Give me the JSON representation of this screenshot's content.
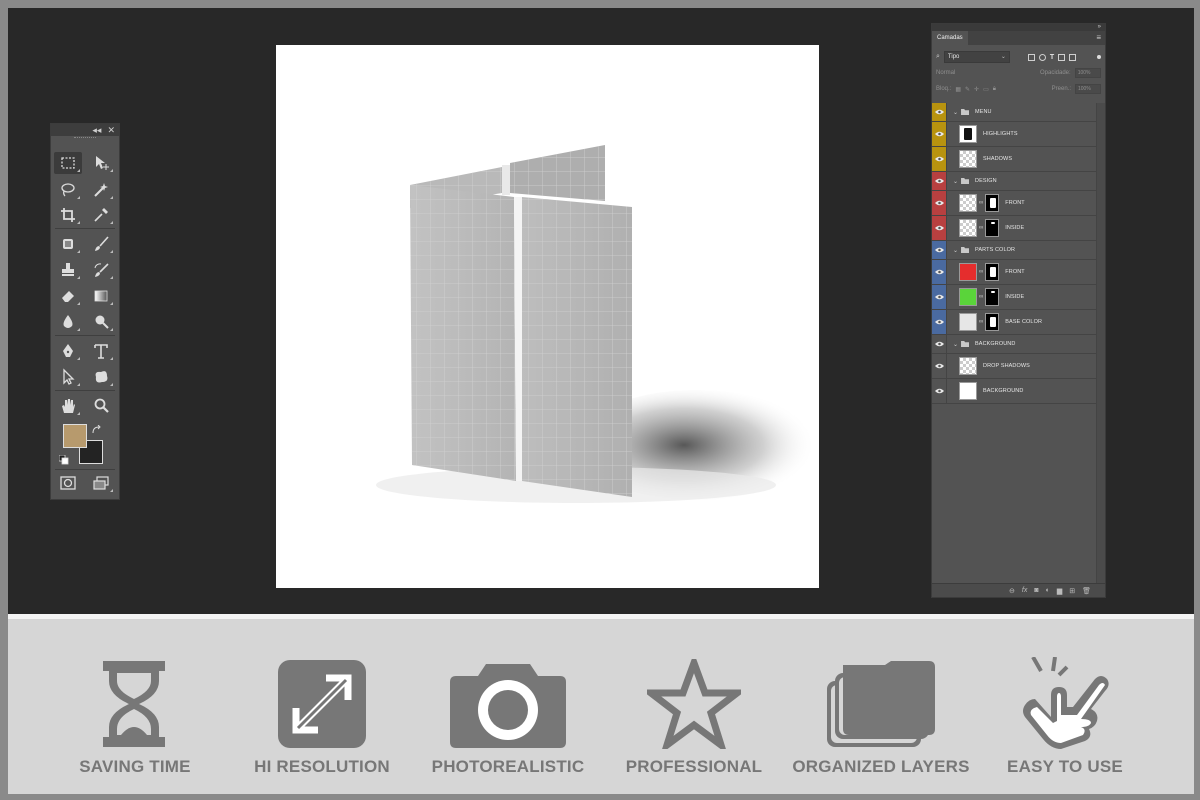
{
  "layers_panel": {
    "title": "Camadas",
    "collapse_glyph": "»",
    "menu_glyph": "≡",
    "filter_value": "Tipo",
    "blend_mode": "Normal",
    "opacity_label": "Opacidade:",
    "opacity_value": "100%",
    "lock_label": "Bloq.:",
    "fill_label": "Preen.:",
    "fill_value": "100%",
    "layers": [
      {
        "kind": "group",
        "name": "MENU",
        "tag_color": "#b8930f"
      },
      {
        "kind": "layer",
        "name": "HIGHLIGHTS",
        "tag_color": "#b8930f",
        "thumb": "highlight"
      },
      {
        "kind": "layer",
        "name": "SHADOWS",
        "tag_color": "#b8930f",
        "thumb": "checker"
      },
      {
        "kind": "group",
        "name": "DESIGN",
        "tag_color": "#b84040"
      },
      {
        "kind": "layer",
        "name": "FRONT",
        "tag_color": "#b84040",
        "thumb": "checker",
        "mask": "white-rect"
      },
      {
        "kind": "layer",
        "name": "INSIDE",
        "tag_color": "#b84040",
        "thumb": "checker",
        "mask": "small"
      },
      {
        "kind": "group",
        "name": "PARTS COLOR",
        "tag_color": "#4a6aa0"
      },
      {
        "kind": "layer",
        "name": "FRONT",
        "tag_color": "#4a6aa0",
        "thumb": "#e52d2d",
        "mask": "white-rect"
      },
      {
        "kind": "layer",
        "name": "INSIDE",
        "tag_color": "#4a6aa0",
        "thumb": "#5ad43a",
        "mask": "small"
      },
      {
        "kind": "layer",
        "name": "BASE COLOR",
        "tag_color": "#4a6aa0",
        "thumb": "#e6e6e6",
        "mask": "white-rect"
      },
      {
        "kind": "group",
        "name": "BACKGROUND",
        "tag_color": ""
      },
      {
        "kind": "layer",
        "name": "DROP SHADOWS",
        "tag_color": "",
        "thumb": "checker"
      },
      {
        "kind": "layer",
        "name": "BACKGROUND",
        "tag_color": "",
        "thumb": "#ffffff"
      }
    ],
    "bottom_icons": [
      "link-icon",
      "fx-icon",
      "mask-icon",
      "adjustment-icon",
      "folder-icon",
      "new-layer-icon",
      "trash-icon"
    ]
  },
  "tools_panel": {
    "header_glyphs": [
      "◂◂",
      "✕"
    ],
    "foreground_color": "#b79a6d",
    "background_color": "#232323"
  },
  "colors": {
    "workspace_bg": "#282828",
    "feature_bg": "#d6d6d6",
    "feature_icon": "#777777"
  },
  "features": [
    {
      "label": "SAVING TIME",
      "icon": "hourglass-icon"
    },
    {
      "label": "HI RESOLUTION",
      "icon": "expand-icon"
    },
    {
      "label": "PHOTOREALISTIC",
      "icon": "camera-icon"
    },
    {
      "label": "PROFESSIONAL",
      "icon": "star-icon"
    },
    {
      "label": "ORGANIZED LAYERS",
      "icon": "layers-folder-icon"
    },
    {
      "label": "EASY TO USE",
      "icon": "pointing-hand-icon"
    }
  ]
}
